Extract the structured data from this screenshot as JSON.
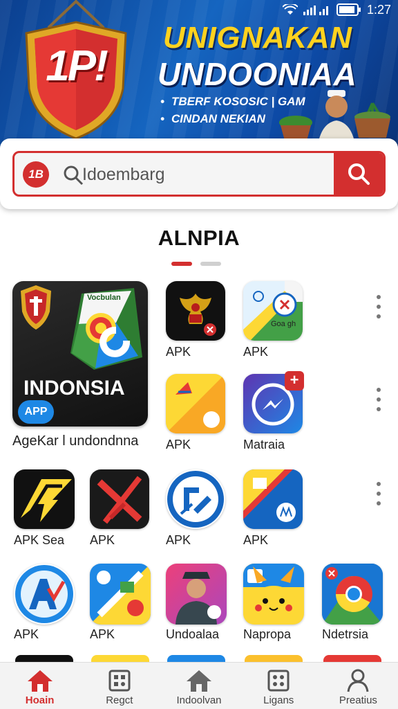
{
  "status_bar": {
    "time": "1:27"
  },
  "banner": {
    "logo_text": "1P!",
    "title_line1": "UNIGNAKAN",
    "title_line2": "UNDOONIAA",
    "bullets": [
      "TBERF KOSOSIC | GAM",
      "CINDAN NEKIAN"
    ]
  },
  "search": {
    "logo_text": "1B",
    "placeholder": "Idoembarg",
    "icons": {
      "left": "search-icon",
      "button": "search-icon"
    }
  },
  "section": {
    "title": "ALNPIA",
    "page_indicator": {
      "count": 2,
      "active": 0
    }
  },
  "featured_app": {
    "title": "INDONSIA",
    "badge": "APP",
    "ribbon": "Vocbulan",
    "label": "AgeKar l undondnna"
  },
  "apps": [
    {
      "label": "APK",
      "icon": "garuda-emblem-icon"
    },
    {
      "label": "APK",
      "icon": "map-compass-icon"
    },
    {
      "label": "APK",
      "icon": "yellow-folder-icon"
    },
    {
      "label": "Matraia",
      "icon": "messenger-icon"
    },
    {
      "label": "APK Sea",
      "icon": "yellow-slash-icon"
    },
    {
      "label": "APK",
      "icon": "red-x-icon"
    },
    {
      "label": "APK",
      "icon": "blue-tools-icon"
    },
    {
      "label": "APK",
      "icon": "split-map-icon"
    },
    {
      "label": "APK",
      "icon": "blue-av-icon"
    },
    {
      "label": "APK",
      "icon": "yellow-blue-split-icon"
    },
    {
      "label": "Undoalaa",
      "icon": "officer-portrait-icon"
    },
    {
      "label": "Napropa",
      "icon": "pikachu-icon"
    },
    {
      "label": "Ndetrsia",
      "icon": "chrome-map-icon"
    }
  ],
  "apk_small_text": "Goa gh",
  "bottom_nav": [
    {
      "label": "Hoain",
      "icon": "home-icon",
      "active": true
    },
    {
      "label": "Regct",
      "icon": "grid-app-icon",
      "active": false
    },
    {
      "label": "Indoolvan",
      "icon": "home-outline-icon",
      "active": false
    },
    {
      "label": "Ligans",
      "icon": "grid-dots-icon",
      "active": false
    },
    {
      "label": "Preatius",
      "icon": "person-icon",
      "active": false
    }
  ],
  "colors": {
    "accent": "#d32f2f",
    "banner_blue": "#1565c0",
    "title_yellow": "#ffd21f"
  }
}
